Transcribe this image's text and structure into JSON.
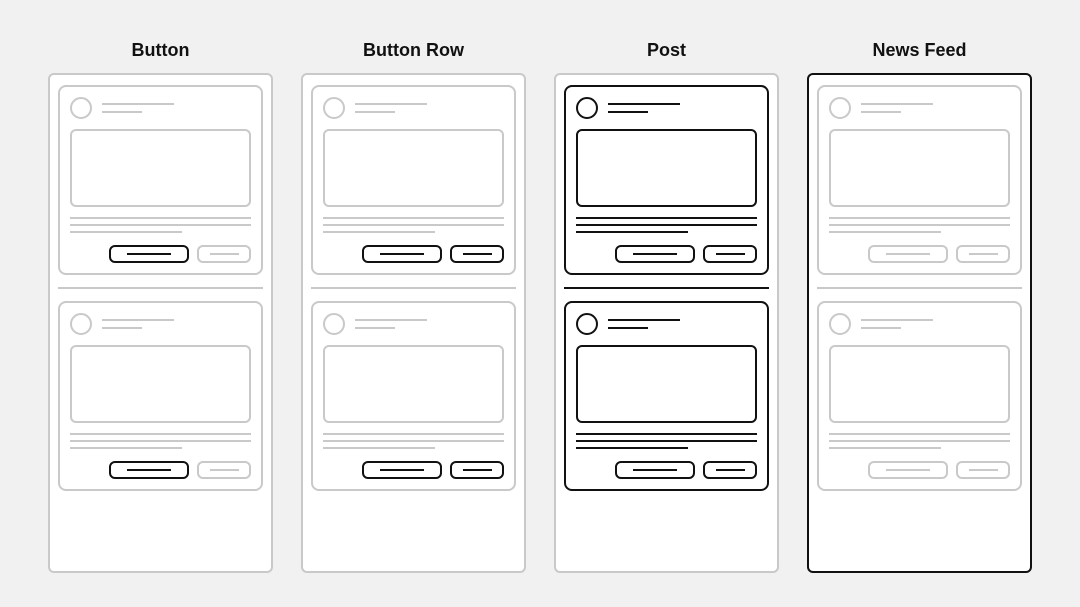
{
  "diagram": {
    "columns": [
      {
        "title": "Button",
        "emphasis": "button"
      },
      {
        "title": "Button Row",
        "emphasis": "button-row"
      },
      {
        "title": "Post",
        "emphasis": "post"
      },
      {
        "title": "News Feed",
        "emphasis": "news-feed"
      }
    ]
  }
}
